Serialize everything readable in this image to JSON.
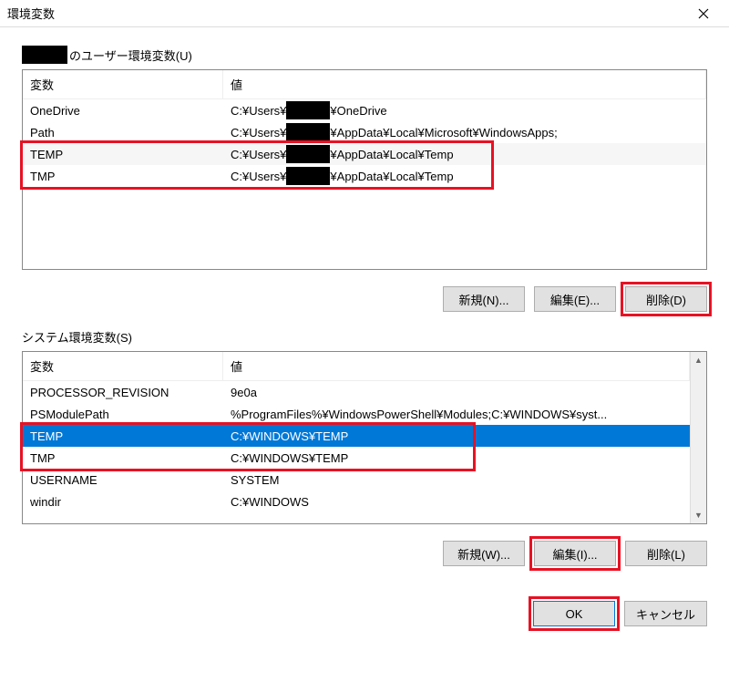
{
  "window": {
    "title": "環境変数"
  },
  "userSection": {
    "labelSuffix": "のユーザー環境変数(U)",
    "headers": {
      "var": "変数",
      "val": "値"
    },
    "rows": [
      {
        "var": "OneDrive",
        "prefix": "C:¥Users¥",
        "suffix": "¥OneDrive"
      },
      {
        "var": "Path",
        "prefix": "C:¥Users¥",
        "suffix": "¥AppData¥Local¥Microsoft¥WindowsApps;"
      },
      {
        "var": "TEMP",
        "prefix": "C:¥Users¥",
        "suffix": "¥AppData¥Local¥Temp"
      },
      {
        "var": "TMP",
        "prefix": "C:¥Users¥",
        "suffix": "¥AppData¥Local¥Temp"
      }
    ],
    "buttons": {
      "new": "新規(N)...",
      "edit": "編集(E)...",
      "delete": "削除(D)"
    }
  },
  "sysSection": {
    "label": "システム環境変数(S)",
    "headers": {
      "var": "変数",
      "val": "値"
    },
    "rows": [
      {
        "var": "PROCESSOR_REVISION",
        "val": "9e0a"
      },
      {
        "var": "PSModulePath",
        "val": "%ProgramFiles%¥WindowsPowerShell¥Modules;C:¥WINDOWS¥syst..."
      },
      {
        "var": "TEMP",
        "val": "C:¥WINDOWS¥TEMP",
        "selected": true
      },
      {
        "var": "TMP",
        "val": "C:¥WINDOWS¥TEMP"
      },
      {
        "var": "USERNAME",
        "val": "SYSTEM"
      },
      {
        "var": "windir",
        "val": "C:¥WINDOWS"
      }
    ],
    "buttons": {
      "new": "新規(W)...",
      "edit": "編集(I)...",
      "delete": "削除(L)"
    }
  },
  "dialog": {
    "ok": "OK",
    "cancel": "キャンセル"
  }
}
